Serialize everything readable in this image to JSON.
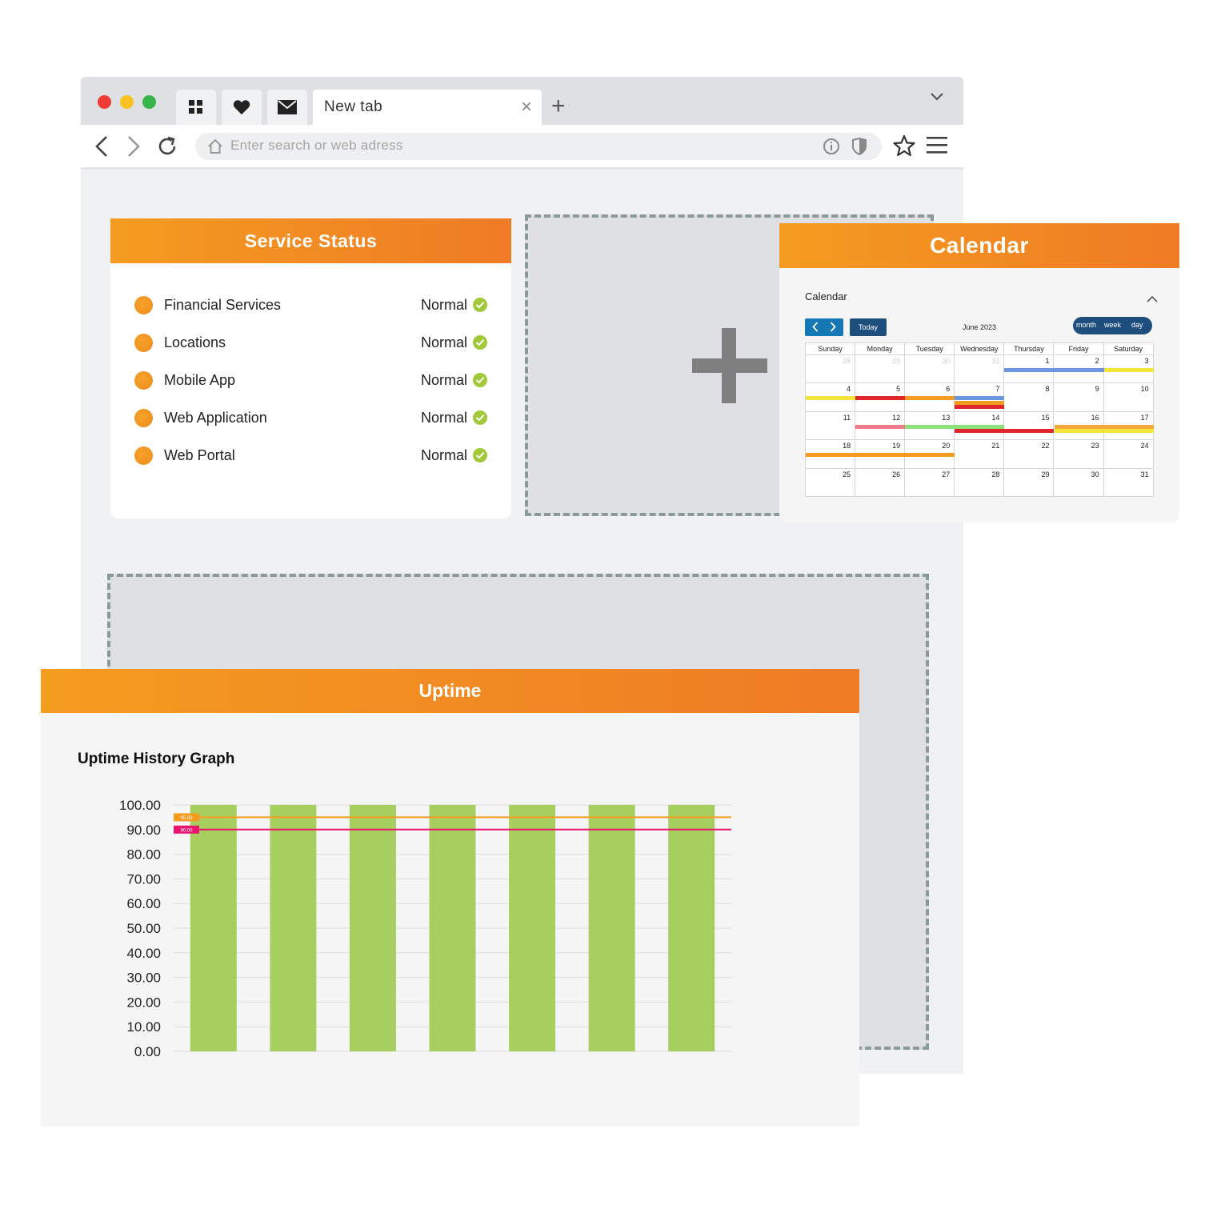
{
  "browser": {
    "tab_title": "New tab",
    "url_placeholder": "Enter search or web adress",
    "pinned_tabs": [
      "apps-icon",
      "heart-icon",
      "mail-icon"
    ]
  },
  "service_status": {
    "title": "Service Status",
    "items": [
      {
        "name": "Financial Services",
        "status": "Normal"
      },
      {
        "name": "Locations",
        "status": "Normal"
      },
      {
        "name": "Mobile App",
        "status": "Normal"
      },
      {
        "name": "Web Application",
        "status": "Normal"
      },
      {
        "name": "Web Portal",
        "status": "Normal"
      }
    ]
  },
  "calendar": {
    "title": "Calendar",
    "label": "Calendar",
    "today_label": "Today",
    "month_label": "June 2023",
    "views": [
      "month",
      "week",
      "day"
    ],
    "day_names": [
      "Sunday",
      "Monday",
      "Tuesday",
      "Wednesday",
      "Thursday",
      "Friday",
      "Saturday"
    ],
    "weeks": [
      [
        "28",
        "29",
        "30",
        "31",
        "1",
        "2",
        "3"
      ],
      [
        "4",
        "5",
        "6",
        "7",
        "8",
        "9",
        "10"
      ],
      [
        "11",
        "12",
        "13",
        "14",
        "15",
        "16",
        "17"
      ],
      [
        "18",
        "19",
        "20",
        "21",
        "22",
        "23",
        "24"
      ],
      [
        "25",
        "26",
        "27",
        "28",
        "29",
        "30",
        "31"
      ]
    ],
    "muted_days": [
      [
        0,
        0
      ],
      [
        0,
        1
      ],
      [
        0,
        2
      ],
      [
        0,
        3
      ]
    ],
    "events": [
      {
        "week": 0,
        "start": 4,
        "end": 5,
        "lane": 0,
        "color": "#6b97e0"
      },
      {
        "week": 0,
        "start": 6,
        "end": 6,
        "lane": 0,
        "color": "#f5e53a"
      },
      {
        "week": 1,
        "start": 0,
        "end": 0,
        "lane": 0,
        "color": "#f5e53a"
      },
      {
        "week": 1,
        "start": 1,
        "end": 1,
        "lane": 0,
        "color": "#e0262b"
      },
      {
        "week": 1,
        "start": 2,
        "end": 2,
        "lane": 0,
        "color": "#f59b1f"
      },
      {
        "week": 1,
        "start": 3,
        "end": 3,
        "lane": 0,
        "color": "#6b97e0"
      },
      {
        "week": 1,
        "start": 3,
        "end": 3,
        "lane": 1,
        "color": "#f59b1f"
      },
      {
        "week": 1,
        "start": 3,
        "end": 3,
        "lane": 2,
        "color": "#e0262b"
      },
      {
        "week": 2,
        "start": 1,
        "end": 1,
        "lane": 0,
        "color": "#f07a8a"
      },
      {
        "week": 2,
        "start": 2,
        "end": 3,
        "lane": 0,
        "color": "#8ee07a"
      },
      {
        "week": 2,
        "start": 3,
        "end": 4,
        "lane": 1,
        "color": "#e0262b"
      },
      {
        "week": 2,
        "start": 5,
        "end": 6,
        "lane": 0,
        "color": "#f5a83a"
      },
      {
        "week": 2,
        "start": 5,
        "end": 6,
        "lane": 1,
        "color": "#f5e53a"
      },
      {
        "week": 3,
        "start": 0,
        "end": 2,
        "lane": 0,
        "color": "#f59b1f"
      }
    ]
  },
  "uptime": {
    "title": "Uptime",
    "graph_title": "Uptime History Graph"
  },
  "chart_data": {
    "type": "bar",
    "title": "Uptime History Graph",
    "categories": [
      "",
      "",
      "",
      "",
      "",
      "",
      ""
    ],
    "values": [
      100,
      100,
      100,
      100,
      100,
      100,
      100
    ],
    "ylim": [
      0,
      100
    ],
    "yticks": [
      "100.00",
      "90.00",
      "80.00",
      "70.00",
      "60.00",
      "50.00",
      "40.00",
      "30.00",
      "20.00",
      "10.00",
      "0.00"
    ],
    "ytick_values": [
      100,
      90,
      80,
      70,
      60,
      50,
      40,
      30,
      20,
      10,
      0
    ],
    "bar_color": "#a7cf5f",
    "grid": true,
    "thresholds": [
      {
        "value": 95,
        "label": "95.00",
        "color": "#f59b1f"
      },
      {
        "value": 90,
        "label": "90.00",
        "color": "#e8146e"
      }
    ]
  }
}
